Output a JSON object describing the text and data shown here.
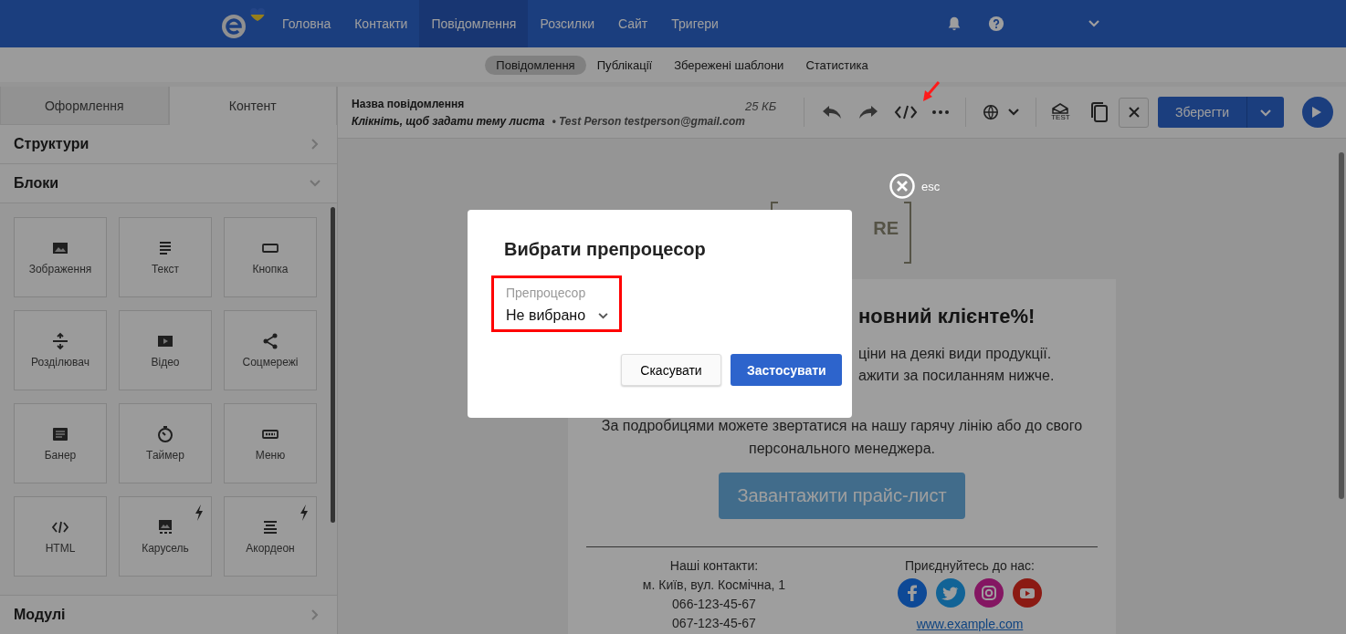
{
  "nav": {
    "items": [
      {
        "label": "Головна",
        "selected": false
      },
      {
        "label": "Контакти",
        "selected": false
      },
      {
        "label": "Повідомлення",
        "selected": true
      },
      {
        "label": "Розсилки",
        "selected": false
      },
      {
        "label": "Сайт",
        "selected": false
      },
      {
        "label": "Тригери",
        "selected": false
      }
    ]
  },
  "subnav": {
    "items": [
      {
        "label": "Повідомлення",
        "selected": true
      },
      {
        "label": "Публікації",
        "selected": false
      },
      {
        "label": "Збережені шаблони",
        "selected": false
      },
      {
        "label": "Статистика",
        "selected": false
      }
    ]
  },
  "editor": {
    "name": "Назва повідомлення",
    "subject": "Клікніть, щоб задати тему листа",
    "sender": "• Test Person testperson@gmail.com",
    "size": "25 КБ",
    "test_label": "TEST",
    "save": "Зберегти"
  },
  "sidebar": {
    "tabs": [
      {
        "label": "Оформлення",
        "selected": false
      },
      {
        "label": "Контент",
        "selected": true
      }
    ],
    "sections": [
      {
        "label": "Структури",
        "expanded": false
      },
      {
        "label": "Блоки",
        "expanded": true
      }
    ],
    "blocks": [
      {
        "label": "Зображення",
        "kind": "image",
        "premium": false
      },
      {
        "label": "Текст",
        "kind": "text",
        "premium": false
      },
      {
        "label": "Кнопка",
        "kind": "button",
        "premium": false
      },
      {
        "label": "Розділювач",
        "kind": "divider",
        "premium": false
      },
      {
        "label": "Відео",
        "kind": "video",
        "premium": false
      },
      {
        "label": "Соцмережі",
        "kind": "share",
        "premium": false
      },
      {
        "label": "Банер",
        "kind": "banner",
        "premium": false
      },
      {
        "label": "Таймер",
        "kind": "timer",
        "premium": false
      },
      {
        "label": "Меню",
        "kind": "menu",
        "premium": false
      },
      {
        "label": "HTML",
        "kind": "code",
        "premium": false
      },
      {
        "label": "Карусель",
        "kind": "carousel",
        "premium": true
      },
      {
        "label": "Акордеон",
        "kind": "accordion",
        "premium": true
      }
    ],
    "footer_section": {
      "label": "Модулі",
      "expanded": false
    }
  },
  "email": {
    "logo_text": "RE",
    "heading": "новний клієнте%!",
    "lines": [
      "ціни на деякі види продукції.",
      "ажити за посиланням нижче."
    ],
    "paragraph": "За подробицями можете звертатися на нашу гарячу лінію або до свого персонального менеджера.",
    "button": "Завантажити прайс-лист",
    "contacts": [
      "Наші контакти:",
      "м. Київ, вул. Космічна, 1",
      "066-123-45-67",
      "067-123-45-67"
    ],
    "social_title": "Приєднуйтесь до нас:",
    "social": [
      {
        "kind": "facebook"
      },
      {
        "kind": "twitter"
      },
      {
        "kind": "instagram"
      },
      {
        "kind": "youtube"
      }
    ],
    "website": "www.example.com"
  },
  "modal": {
    "close_label": "esc",
    "title": "Вибрати препроцесор",
    "field": {
      "label": "Препроцесор",
      "value": "Не вибрано",
      "highlighted": true
    },
    "buttons": [
      {
        "label": "Скасувати",
        "kind": "secondary"
      },
      {
        "label": "Застосувати",
        "kind": "primary"
      }
    ]
  }
}
